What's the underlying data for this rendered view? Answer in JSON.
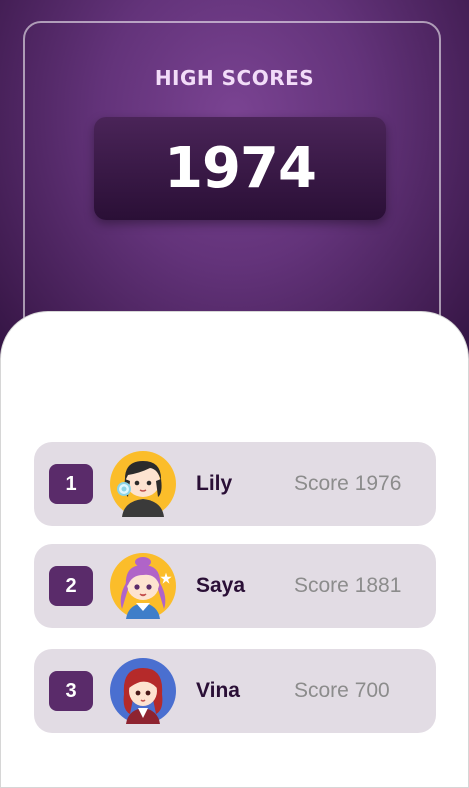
{
  "header": {
    "title": "HIGH SCORES",
    "best_score": "1974"
  },
  "leaderboard": [
    {
      "rank": "1",
      "name": "Lily",
      "score_label": "Score",
      "score": "1976",
      "avatar_icon": "girl-headset-avatar-icon",
      "avatar_bg": "#fbbd2a"
    },
    {
      "rank": "2",
      "name": "Saya",
      "score_label": "Score",
      "score": "1881",
      "avatar_icon": "girl-purple-hair-avatar-icon",
      "avatar_bg": "#fbbd2a"
    },
    {
      "rank": "3",
      "name": "Vina",
      "score_label": "Score",
      "score": "700",
      "avatar_icon": "girl-red-hair-avatar-icon",
      "avatar_bg": "#4a6fd0"
    }
  ],
  "colors": {
    "header_purple": "#63337a",
    "rank_badge": "#5a2b6a",
    "row_bg": "#e2dce4"
  }
}
